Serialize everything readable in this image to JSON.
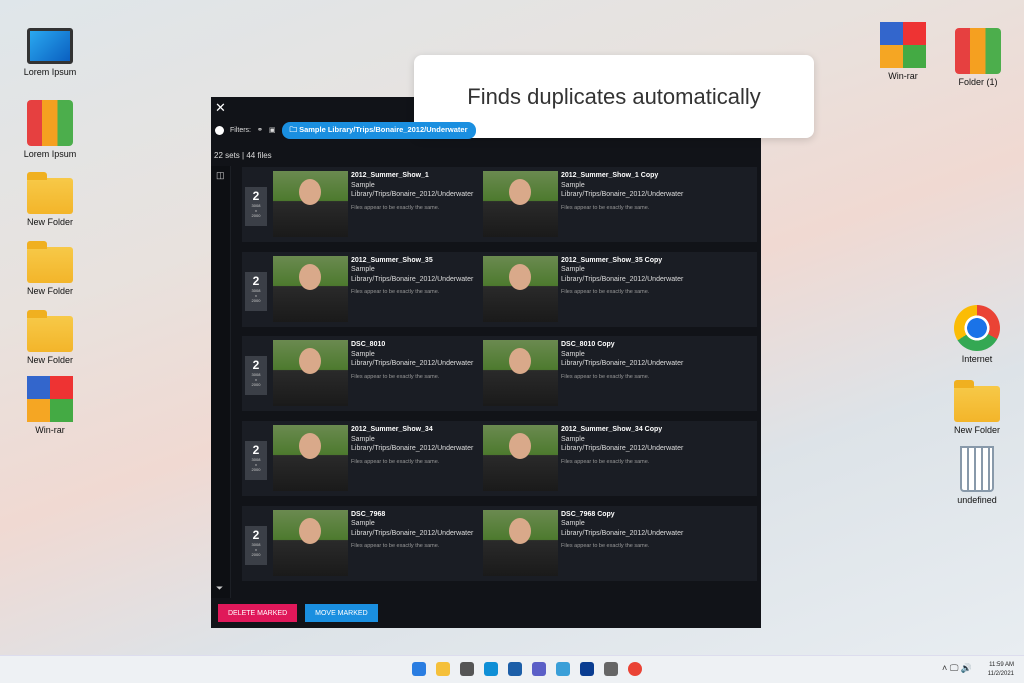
{
  "desktop": {
    "left": [
      "Lorem Ipsum",
      "Lorem Ipsum",
      "New Folder",
      "New Folder",
      "New Folder",
      "Win-rar"
    ],
    "right": [
      "Win-rar",
      "Folder (1)",
      "Internet",
      "New Folder"
    ]
  },
  "toast": "Finds duplicates automatically",
  "window": {
    "filters_label": "Filters:",
    "path_chip": "Sample Library/Trips/Bonaire_2012/Underwater",
    "summary": "22 sets  |  44 files",
    "sets": [
      {
        "count": "2",
        "dims": [
          "3008",
          "x",
          "2000"
        ],
        "items": [
          {
            "name": "2012_Summer_Show_1",
            "path1": "Sample",
            "path2": "Library/Trips/Bonaire_2012/Underwater",
            "note": "Files appear to be exactly the same."
          },
          {
            "name": "2012_Summer_Show_1 Copy",
            "path1": "Sample",
            "path2": "Library/Trips/Bonaire_2012/Underwater",
            "note": "Files appear to be exactly the same."
          }
        ]
      },
      {
        "count": "2",
        "dims": [
          "3008",
          "x",
          "2000"
        ],
        "items": [
          {
            "name": "2012_Summer_Show_35",
            "path1": "Sample",
            "path2": "Library/Trips/Bonaire_2012/Underwater",
            "note": "Files appear to be exactly the same."
          },
          {
            "name": "2012_Summer_Show_35 Copy",
            "path1": "Sample",
            "path2": "Library/Trips/Bonaire_2012/Underwater",
            "note": "Files appear to be exactly the same."
          }
        ]
      },
      {
        "count": "2",
        "dims": [
          "3008",
          "x",
          "2000"
        ],
        "items": [
          {
            "name": "DSC_8010",
            "path1": "Sample",
            "path2": "Library/Trips/Bonaire_2012/Underwater",
            "note": "Files appear to be exactly the same."
          },
          {
            "name": "DSC_8010 Copy",
            "path1": "Sample",
            "path2": "Library/Trips/Bonaire_2012/Underwater",
            "note": "Files appear to be exactly the same."
          }
        ]
      },
      {
        "count": "2",
        "dims": [
          "3008",
          "x",
          "2000"
        ],
        "items": [
          {
            "name": "2012_Summer_Show_34",
            "path1": "Sample",
            "path2": "Library/Trips/Bonaire_2012/Underwater",
            "note": "Files appear to be exactly the same."
          },
          {
            "name": "2012_Summer_Show_34 Copy",
            "path1": "Sample",
            "path2": "Library/Trips/Bonaire_2012/Underwater",
            "note": "Files appear to be exactly the same."
          }
        ]
      },
      {
        "count": "2",
        "dims": [
          "3008",
          "x",
          "2000"
        ],
        "items": [
          {
            "name": "DSC_7968",
            "path1": "Sample",
            "path2": "Library/Trips/Bonaire_2012/Underwater",
            "note": "Files appear to be exactly the same."
          },
          {
            "name": "DSC_7968 Copy",
            "path1": "Sample",
            "path2": "Library/Trips/Bonaire_2012/Underwater",
            "note": "Files appear to be exactly the same."
          }
        ]
      }
    ],
    "delete_label": "DELETE MARKED",
    "move_label": "MOVE MARKED"
  },
  "colors": {
    "delete": "#e0185a",
    "move": "#1a8fe0"
  },
  "taskbar": {
    "time": "11:59 AM",
    "date": "11/2/2021"
  }
}
